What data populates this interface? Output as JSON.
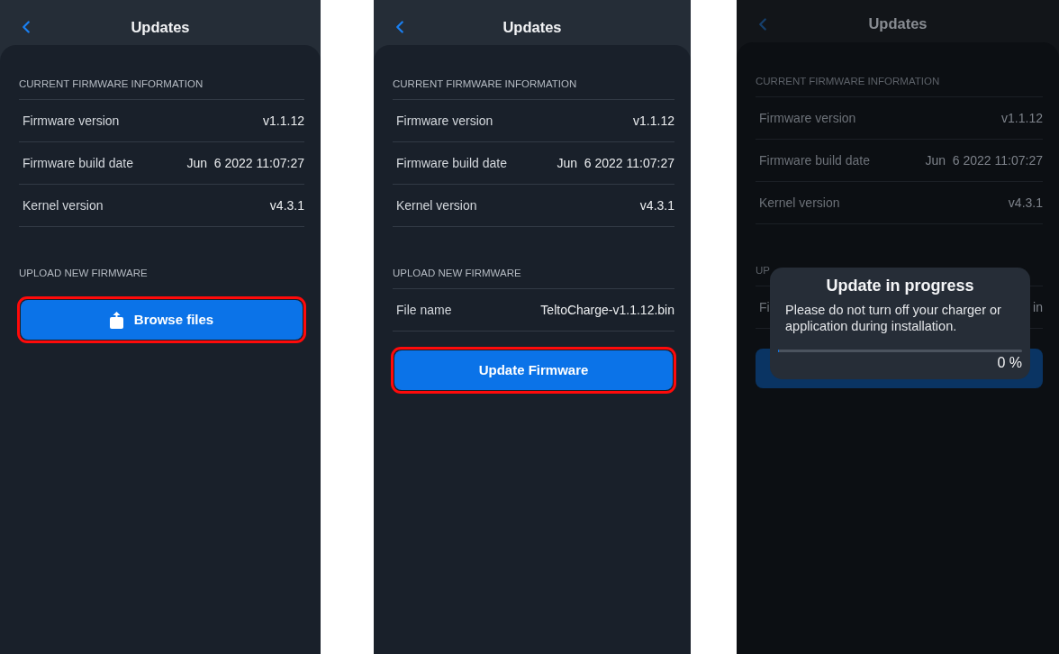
{
  "screens": [
    {
      "dimmed": false,
      "header": {
        "title": "Updates"
      },
      "sections": [
        {
          "heading": "CURRENT FIRMWARE INFORMATION",
          "rows": [
            {
              "label": "Firmware version",
              "value": "v1.1.12"
            },
            {
              "label": "Firmware build date",
              "value": "Jun  6 2022 11:07:27"
            },
            {
              "label": "Kernel version",
              "value": "v4.3.1"
            }
          ]
        },
        {
          "heading": "UPLOAD NEW FIRMWARE"
        }
      ],
      "button": {
        "kind": "browse",
        "label": "Browse files",
        "highlighted": true
      }
    },
    {
      "dimmed": false,
      "header": {
        "title": "Updates"
      },
      "sections": [
        {
          "heading": "CURRENT FIRMWARE INFORMATION",
          "rows": [
            {
              "label": "Firmware version",
              "value": "v1.1.12"
            },
            {
              "label": "Firmware build date",
              "value": "Jun  6 2022 11:07:27"
            },
            {
              "label": "Kernel version",
              "value": "v4.3.1"
            }
          ]
        },
        {
          "heading": "UPLOAD NEW FIRMWARE",
          "rows": [
            {
              "label": "File name",
              "value": "TeltoCharge-v1.1.12.bin"
            }
          ]
        }
      ],
      "button": {
        "kind": "update",
        "label": "Update Firmware",
        "highlighted": true
      }
    },
    {
      "dimmed": true,
      "header": {
        "title": "Updates"
      },
      "sections": [
        {
          "heading": "CURRENT FIRMWARE INFORMATION",
          "rows": [
            {
              "label": "Firmware version",
              "value": "v1.1.12"
            },
            {
              "label": "Firmware build date",
              "value": "Jun  6 2022 11:07:27"
            },
            {
              "label": "Kernel version",
              "value": "v4.3.1"
            }
          ]
        },
        {
          "heading": "UP",
          "rows": [
            {
              "label": "Fi",
              "value": "in"
            }
          ]
        }
      ],
      "button": {
        "kind": "update",
        "highlighted": false
      },
      "dialog": {
        "title": "Update in progress",
        "message": "Please do not turn off your charger or application during installation.",
        "progress": {
          "level": 0,
          "reading": "0 %"
        }
      }
    }
  ]
}
